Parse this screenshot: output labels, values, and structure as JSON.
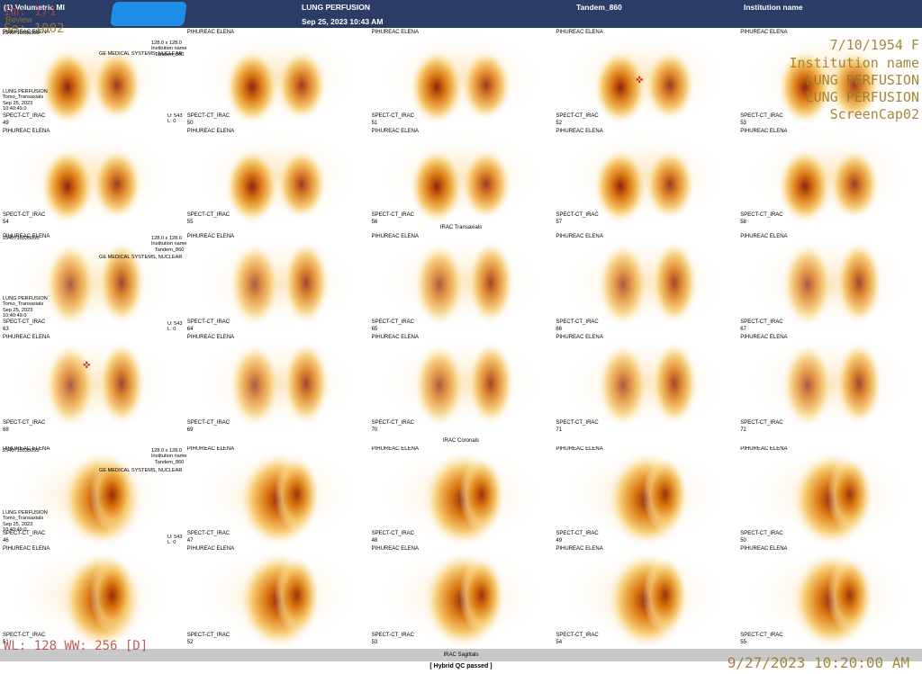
{
  "header": {
    "left_title": "(1) Volumetric MI",
    "center_title": "LUNG PERFUSION",
    "datetime": "Sep 25, 2023 10:43 AM",
    "device": "Tandem_860",
    "institution": "Institution name"
  },
  "overlay": {
    "im": "Im: 1/1",
    "review": "Review",
    "se": "Se: 1002",
    "wl": "WL: 128 WW: 256 [D]",
    "dob_sex": "7/10/1954 F",
    "institution": "Institution name",
    "study1": "LUNG PERFUSION",
    "study2": "LUNG PERFUSION",
    "screencap": "ScreenCap02",
    "timestamp": "9/27/2023 10:20:00 AM"
  },
  "patient": "PIHUREAC ELENA",
  "series_name": "SPECT-CT_IRAC",
  "info_block": {
    "id": "2540710335055",
    "matrix": "128.0 x 128.0",
    "institution": "Institution name",
    "device": "Tandem_860",
    "maker": "GE MEDICAL SYSTEMS, NUCLEAR",
    "study": "LUNG PERFUSION",
    "tomo": "Tomo_Transaxials",
    "date": "Sep 25, 2023",
    "time": "10:40:49.0",
    "u": "U: 543",
    "l": "L: 0"
  },
  "section_labels": {
    "transaxials": "IRAC Transaxials",
    "coronals": "IRAC Coronals",
    "sagittals": "IRAC Sagittals"
  },
  "qc": "[ Hybrid QC passed ]",
  "rows": [
    {
      "nums": [
        "49",
        "50",
        "51",
        "52",
        "53"
      ],
      "view": "transaxial"
    },
    {
      "nums": [
        "54",
        "55",
        "56",
        "57",
        "58"
      ],
      "view": "transaxial"
    },
    {
      "nums": [
        "63",
        "64",
        "65",
        "66",
        "67"
      ],
      "view": "coronal"
    },
    {
      "nums": [
        "68",
        "69",
        "70",
        "71",
        "72"
      ],
      "view": "coronal"
    },
    {
      "nums": [
        "46",
        "47",
        "48",
        "49",
        "50"
      ],
      "view": "sagittal"
    },
    {
      "nums": [
        "51",
        "52",
        "53",
        "54",
        "55"
      ],
      "view": "sagittal"
    }
  ],
  "colors": {
    "header_bg": "#2b3d66",
    "hot_dark": "#8b1a00",
    "hot_mid": "#d9730a",
    "hot_light": "#f7d99a"
  }
}
